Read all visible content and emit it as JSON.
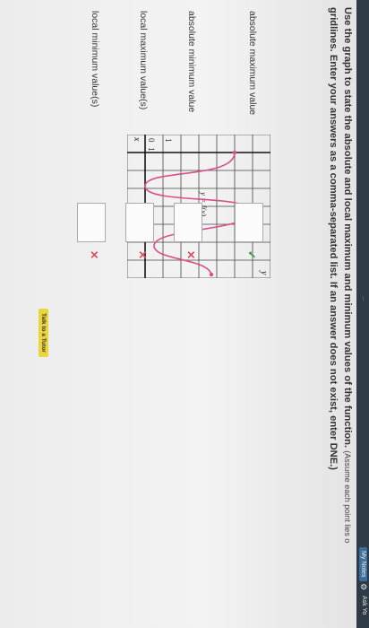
{
  "header": {
    "pager": "...",
    "my_notes_label": "My Notes",
    "ask_label": "Ask Yo"
  },
  "question": {
    "text": "Use the graph to state the absolute and local maximum and minimum values of the function.",
    "hint": "(Assume each point lies o",
    "line2": "gridlines. Enter your answers as a comma-separated list. If an answer does not exist, enter DNE.)"
  },
  "graph": {
    "y_axis_label": "y",
    "x_axis_label": "x",
    "tick_x": "1",
    "tick_y": "1",
    "origin": "0",
    "function_label": "y = f(x)",
    "curve_color": "#d94f8a",
    "grid_color": "#444444"
  },
  "fields": [
    {
      "label": "absolute maximum value",
      "value": "",
      "status": "correct",
      "mark": "✓"
    },
    {
      "label": "absolute minimum value",
      "value": "",
      "status": "incorrect",
      "mark": "✕"
    },
    {
      "label": "local maximum value(s)",
      "value": "",
      "status": "incorrect",
      "mark": "✕"
    },
    {
      "label": "local minimum value(s)",
      "value": "",
      "status": "incorrect",
      "mark": "✕"
    }
  ],
  "tutor_button": "Talk to a Tutor",
  "colors": {
    "correct": "#3a9d3a",
    "incorrect": "#d4505e",
    "tutor": "#ead53d",
    "topbar": "#2f3b46"
  }
}
